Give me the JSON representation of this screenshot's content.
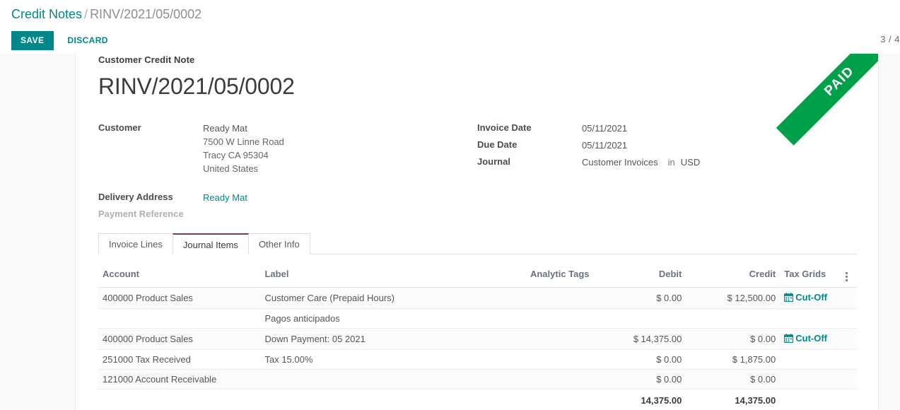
{
  "breadcrumb": {
    "root": "Credit Notes",
    "separator": "/",
    "current": "RINV/2021/05/0002"
  },
  "toolbar": {
    "save_label": "SAVE",
    "discard_label": "DISCARD",
    "pager": "3 / 4"
  },
  "ribbon": {
    "label": "PAID"
  },
  "document": {
    "type_label": "Customer Credit Note",
    "name": "RINV/2021/05/0002"
  },
  "fields_left": {
    "customer_label": "Customer",
    "customer_name": "Ready Mat",
    "customer_address": [
      "7500 W Linne Road",
      "Tracy CA 95304",
      "United States"
    ],
    "delivery_address_label": "Delivery Address",
    "delivery_address_value": "Ready Mat",
    "payment_reference_label": "Payment Reference",
    "payment_reference_value": ""
  },
  "fields_right": {
    "invoice_date_label": "Invoice Date",
    "invoice_date_value": "05/11/2021",
    "due_date_label": "Due Date",
    "due_date_value": "05/11/2021",
    "journal_label": "Journal",
    "journal_value": "Customer Invoices",
    "journal_in_word": "in",
    "currency_value": "USD"
  },
  "tabs": [
    {
      "label": "Invoice Lines",
      "active": false
    },
    {
      "label": "Journal Items",
      "active": true
    },
    {
      "label": "Other Info",
      "active": false
    }
  ],
  "journal_items": {
    "columns": {
      "account": "Account",
      "label": "Label",
      "analytic_tags": "Analytic Tags",
      "debit": "Debit",
      "credit": "Credit",
      "tax_grids": "Tax Grids",
      "options_icon": "vertical-dots-icon"
    },
    "rows": [
      {
        "account": "400000 Product Sales",
        "label": "Customer Care (Prepaid Hours)",
        "label_is_placeholder": false,
        "analytic_tags": "",
        "debit": "$ 0.00",
        "credit": "$ 12,500.00",
        "tax_grids": "Cut-Off",
        "has_cutoff": true,
        "shaded": true
      },
      {
        "account": "",
        "label": "Pagos anticipados",
        "label_is_placeholder": true,
        "analytic_tags": "",
        "debit": "",
        "credit": "",
        "tax_grids": "",
        "has_cutoff": false,
        "shaded": false
      },
      {
        "account": "400000 Product Sales",
        "label": "Down Payment: 05 2021",
        "label_is_placeholder": false,
        "analytic_tags": "",
        "debit": "$ 14,375.00",
        "credit": "$ 0.00",
        "tax_grids": "Cut-Off",
        "has_cutoff": true,
        "shaded": true
      },
      {
        "account": "251000 Tax Received",
        "label": "Tax 15.00%",
        "label_is_placeholder": false,
        "analytic_tags": "",
        "debit": "$ 0.00",
        "credit": "$ 1,875.00",
        "tax_grids": "",
        "has_cutoff": false,
        "shaded": false
      },
      {
        "account": "121000 Account Receivable",
        "label": "",
        "label_is_placeholder": false,
        "analytic_tags": "",
        "debit": "$ 0.00",
        "credit": "$ 0.00",
        "tax_grids": "",
        "has_cutoff": false,
        "shaded": true
      }
    ],
    "totals": {
      "debit": "14,375.00",
      "credit": "14,375.00"
    }
  },
  "colors": {
    "accent_teal": "#00878a",
    "ribbon_green": "#00a04a",
    "active_tab_border": "#7c3c5d",
    "page_bg": "#f9f9f9"
  }
}
